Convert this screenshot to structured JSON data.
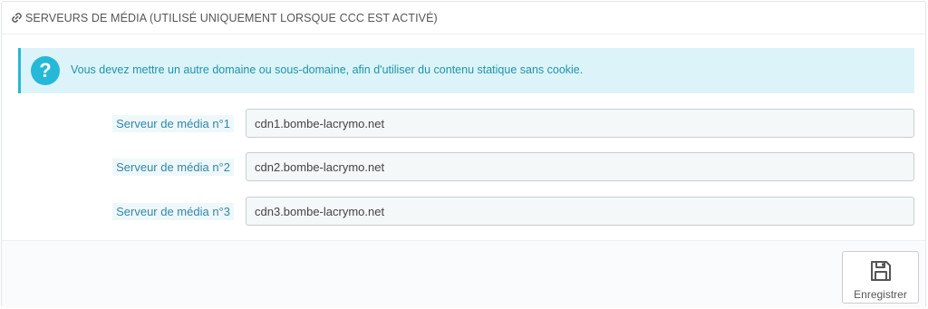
{
  "panel": {
    "title": "Serveurs de média (utilisé uniquement lorsque CCC est activé)",
    "title_icon": "link-icon"
  },
  "alert": {
    "icon": "question-icon",
    "icon_glyph": "?",
    "text": "Vous devez mettre un autre domaine ou sous-domaine, afin d'utiliser du contenu statique sans cookie.",
    "accent_color": "#25b9d7"
  },
  "servers": [
    {
      "label": "Serveur de média n°1",
      "value": "cdn1.bombe-lacrymo.net"
    },
    {
      "label": "Serveur de média n°2",
      "value": "cdn2.bombe-lacrymo.net"
    },
    {
      "label": "Serveur de média n°3",
      "value": "cdn3.bombe-lacrymo.net"
    }
  ],
  "footer": {
    "save_label": "Enregistrer",
    "save_icon": "floppy-disk-icon"
  }
}
